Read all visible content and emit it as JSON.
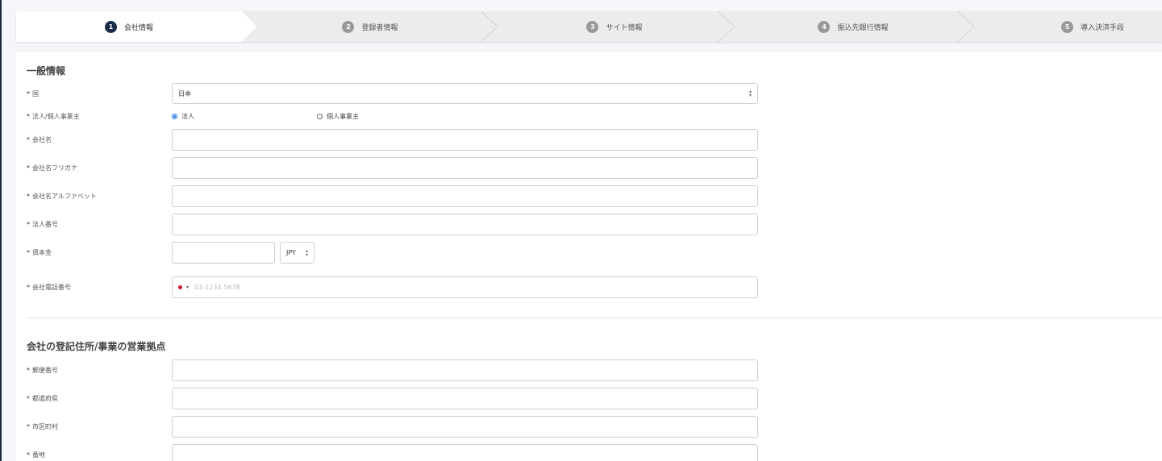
{
  "stepper": [
    {
      "num": "1",
      "label": "会社情報"
    },
    {
      "num": "2",
      "label": "登録者情報"
    },
    {
      "num": "3",
      "label": "サイト情報"
    },
    {
      "num": "4",
      "label": "振込先銀行情報"
    },
    {
      "num": "5",
      "label": "導入決済手段"
    }
  ],
  "general": {
    "title": "一般情報",
    "required_mark": "*",
    "country_label": "国",
    "country_value": "日本",
    "entity_label": "法人/個人事業主",
    "entity_corporate": "法人",
    "entity_sole": "個人事業主",
    "company_name_label": "会社名",
    "company_kana_label": "会社名フリガナ",
    "company_alpha_label": "会社名アルファベット",
    "corp_number_label": "法人番号",
    "capital_label": "資本金",
    "currency_value": "JPY",
    "phone_label": "会社電話番号",
    "phone_placeholder": "03-1234-5678"
  },
  "address": {
    "title": "会社の登記住所/事業の営業拠点",
    "postal_label": "郵便番号",
    "prefecture_label": "都道府県",
    "city_label": "市区町村",
    "street_label": "番地"
  },
  "colors": {
    "active_step": "#1c2b45",
    "inactive_step": "#999999",
    "radio_checked": "#1a73e8"
  }
}
